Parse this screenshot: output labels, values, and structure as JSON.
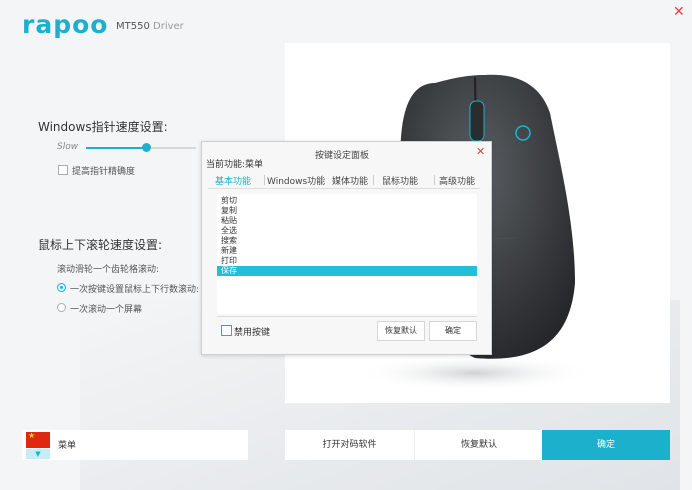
{
  "header": {
    "logo": "rapoo",
    "model": "MT550",
    "driver": "Driver",
    "close_icon": "✕"
  },
  "pointer": {
    "title": "Windows指针速度设置:",
    "slow_label": "Slow",
    "speed_level": 0.55,
    "precision_label": "提高指针精确度"
  },
  "scroll": {
    "title": "鼠标上下滚轮速度设置:",
    "subtitle": "滚动滑轮一个齿轮格滚动:",
    "option1": "一次按键设置鼠标上下行数滚动:",
    "option2": "一次滚动一个屏幕"
  },
  "dialog": {
    "title": "按键设定面板",
    "current_menu": "当前功能:菜单",
    "close_icon": "✕",
    "tabs": [
      "基本功能",
      "Windows功能",
      "媒体功能",
      "鼠标功能",
      "高级功能"
    ],
    "items": [
      "剪切",
      "复制",
      "粘贴",
      "全选",
      "搜索",
      "新建",
      "打印",
      "保存"
    ],
    "selected_index": 7,
    "disable_label": "禁用按键",
    "restore_label": "恢复默认",
    "ok_label": "确定"
  },
  "bottom": {
    "language_label": "菜单",
    "pair_label": "打开对码软件",
    "restore_label": "恢复默认",
    "ok_label": "确定"
  },
  "colors": {
    "accent": "#1bb1cc"
  }
}
